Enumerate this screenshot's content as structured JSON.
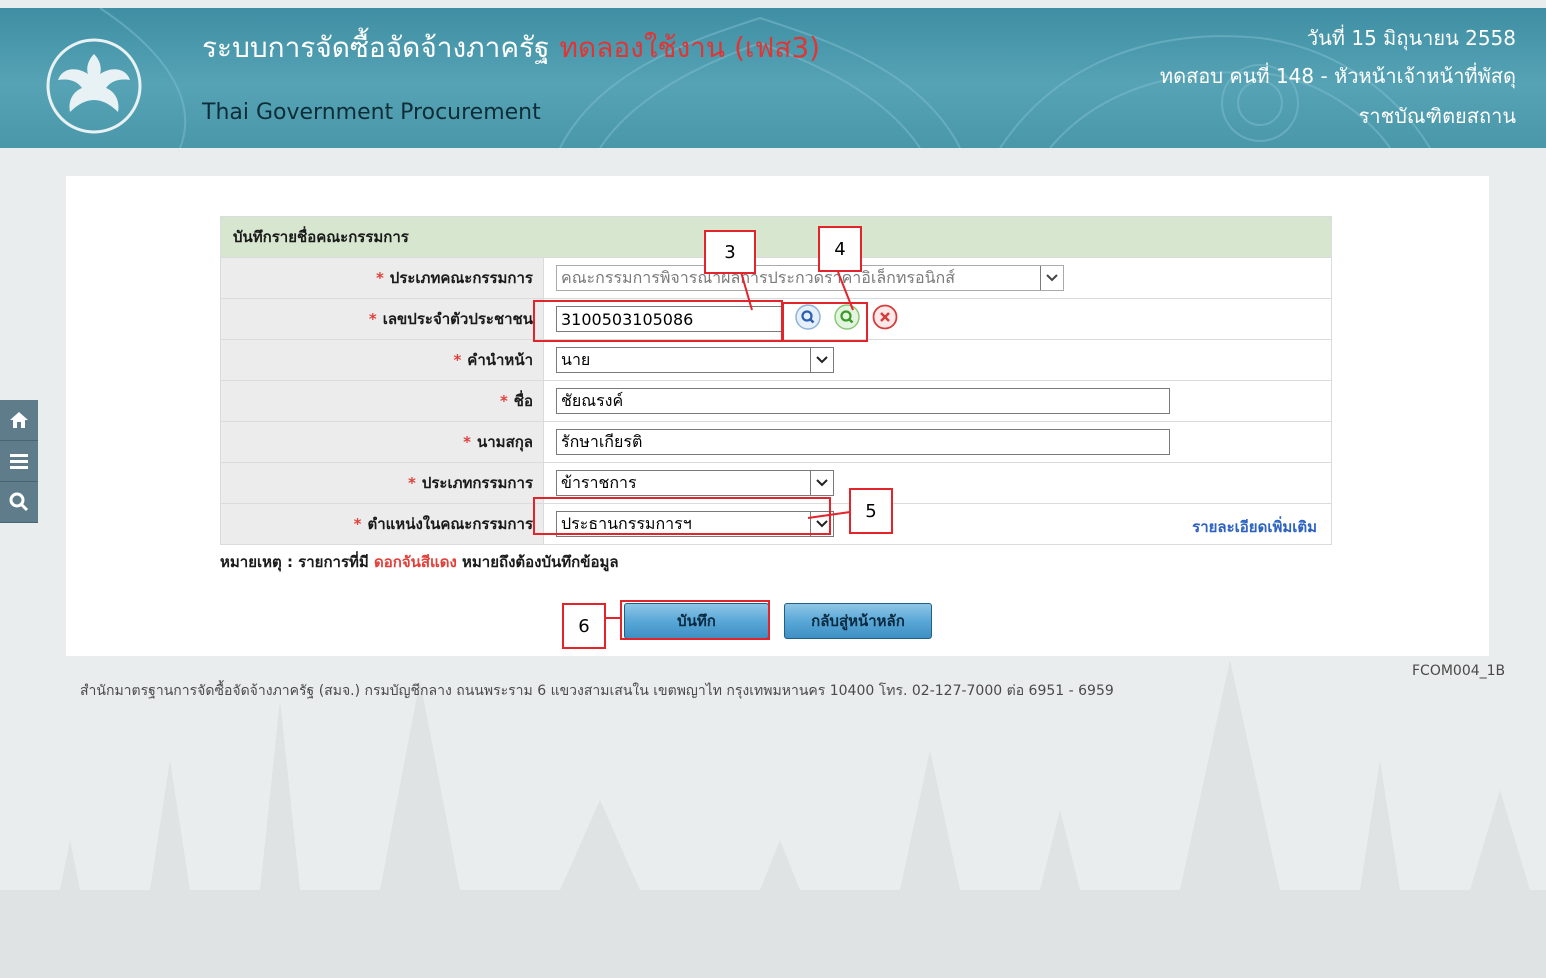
{
  "header": {
    "title": "ระบบการจัดซื้อจัดจ้างภาครัฐ",
    "trial_label": "ทดลองใช้งาน (เฟส3)",
    "subtitle": "Thai Government Procurement",
    "date": "วันที่ 15 มิถุนายน 2558",
    "user": "ทดสอบ คนที่ 148 - หัวหน้าเจ้าหน้าที่พัสดุ",
    "org": "ราชบัณฑิตยสถาน"
  },
  "side_icons": [
    "home-icon",
    "menu-icon",
    "search-icon"
  ],
  "form": {
    "heading": "บันทึกรายชื่อคณะกรรมการ",
    "fields": {
      "committee_type": {
        "label": "ประเภทคณะกรรมการ",
        "value": "คณะกรรมการพิจารณาผลการประกวดราคาอิเล็กทรอนิกส์"
      },
      "citizen_id": {
        "label": "เลขประจำตัวประชาชน",
        "value": "3100503105086"
      },
      "prefix": {
        "label": "คำนำหน้า",
        "value": "นาย"
      },
      "first_name": {
        "label": "ชื่อ",
        "value": "ชัยณรงค์"
      },
      "last_name": {
        "label": "นามสกุล",
        "value": "รักษาเกียรติ"
      },
      "member_type": {
        "label": "ประเภทกรรมการ",
        "value": "ข้าราชการ"
      },
      "position": {
        "label": "ตำแหน่งในคณะกรรมการ",
        "value": "ประธานกรรมการฯ"
      }
    },
    "required_mark": "*",
    "more_details_link": "รายละเอียดเพิ่มเติม",
    "note": {
      "prefix": "หมายเหตุ : รายการที่มี ",
      "highlight": "ดอกจันสีแดง",
      "suffix": " หมายถึงต้องบันทึกข้อมูล"
    },
    "buttons": {
      "save": "บันทึก",
      "back": "กลับสู่หน้าหลัก"
    }
  },
  "footer": {
    "address": "สำนักมาตรฐานการจัดซื้อจัดจ้างภาครัฐ (สมจ.) กรมบัญชีกลาง ถนนพระราม 6 แขวงสามเสนใน เขตพญาไท กรุงเทพมหานคร 10400 โทร. 02-127-7000 ต่อ 6951 - 6959",
    "form_code": "FCOM004_1B"
  },
  "annotations": {
    "a3": "3",
    "a4": "4",
    "a5": "5",
    "a6": "6"
  },
  "colors": {
    "header": "#4a97aa",
    "trial_red": "#e03535",
    "required_red": "#e2403b",
    "link_blue": "#2d62c2",
    "annotation_red": "#e3242b",
    "form_heading_bg": "#d6e6cf"
  }
}
